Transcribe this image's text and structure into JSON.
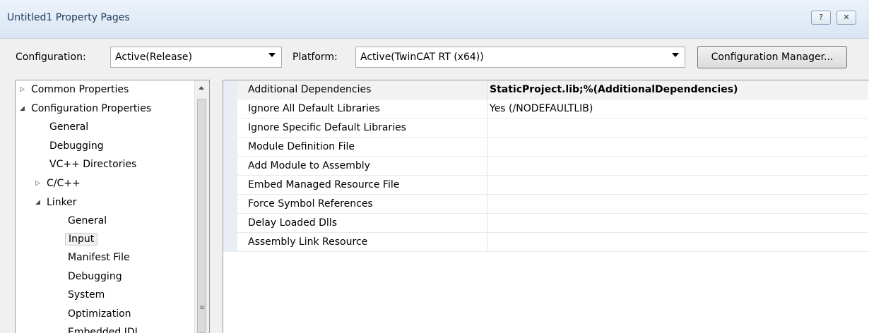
{
  "window": {
    "title": "Untitled1 Property Pages",
    "help_button": "?",
    "close_button": "X"
  },
  "config_bar": {
    "configuration_label": "Configuration:",
    "configuration_value": "Active(Release)",
    "platform_label": "Platform:",
    "platform_value": "Active(TwinCAT RT (x64))",
    "manager_button": "Configuration Manager..."
  },
  "tree": {
    "items": [
      {
        "label": "Common Properties",
        "expander": "collapsed"
      },
      {
        "label": "Configuration Properties",
        "expander": "expanded"
      },
      {
        "label": "General",
        "expander": "none"
      },
      {
        "label": "Debugging",
        "expander": "none"
      },
      {
        "label": "VC++ Directories",
        "expander": "none"
      },
      {
        "label": "C/C++",
        "expander": "collapsed"
      },
      {
        "label": "Linker",
        "expander": "expanded"
      },
      {
        "label": "General",
        "expander": "none"
      },
      {
        "label": "Input",
        "expander": "none",
        "selected": true
      },
      {
        "label": "Manifest File",
        "expander": "none"
      },
      {
        "label": "Debugging",
        "expander": "none"
      },
      {
        "label": "System",
        "expander": "none"
      },
      {
        "label": "Optimization",
        "expander": "none"
      },
      {
        "label": "Embedded IDL",
        "expander": "none"
      }
    ]
  },
  "properties": [
    {
      "name": "Additional Dependencies",
      "value": "StaticProject.lib;%(AdditionalDependencies)",
      "bold": true
    },
    {
      "name": "Ignore All Default Libraries",
      "value": "Yes (/NODEFAULTLIB)",
      "bold": false
    },
    {
      "name": "Ignore Specific Default Libraries",
      "value": "",
      "bold": false
    },
    {
      "name": "Module Definition File",
      "value": "",
      "bold": false
    },
    {
      "name": "Add Module to Assembly",
      "value": "",
      "bold": false
    },
    {
      "name": "Embed Managed Resource File",
      "value": "",
      "bold": false
    },
    {
      "name": "Force Symbol References",
      "value": "",
      "bold": false
    },
    {
      "name": "Delay Loaded Dlls",
      "value": "",
      "bold": false
    },
    {
      "name": "Assembly Link Resource",
      "value": "",
      "bold": false
    }
  ]
}
